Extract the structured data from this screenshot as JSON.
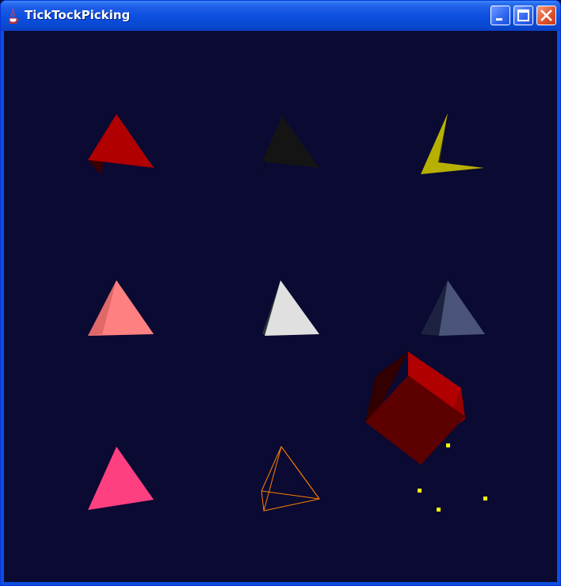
{
  "window": {
    "title": "TickTockPicking",
    "background_color": "#0a0a33",
    "icons": {
      "app": "java-coffee-cup-icon",
      "minimize": "minimize-icon",
      "maximize": "maximize-icon",
      "close": "close-icon"
    }
  },
  "scene": {
    "tetrahedra": [
      {
        "name": "red",
        "front_color": "#b00000",
        "shadow_color": "#3a0000"
      },
      {
        "name": "black",
        "front_color": "#141414",
        "shadow_color": "#050505"
      },
      {
        "name": "yellow",
        "front_color": "#b8b000",
        "shadow_color": "#36360a"
      },
      {
        "name": "salmon",
        "front_color": "#ff8080",
        "shadow_color": "#e06060"
      },
      {
        "name": "white",
        "front_color": "#e0e0e0",
        "shadow_color": "#303838"
      },
      {
        "name": "slate",
        "front_color": "#4a5478",
        "shadow_color": "#1c2240"
      },
      {
        "name": "pink",
        "front_color": "#ff4080",
        "shadow_color": "#d83070"
      },
      {
        "name": "orange-wireframe",
        "front_color": "#ff8000",
        "wireframe": true
      }
    ],
    "cube": {
      "front_color": "#5c0000",
      "top_color": "#b00000",
      "side_color": "#320000",
      "right_color": "#9a0000"
    },
    "points": {
      "color": "#ffff00",
      "count": 4
    }
  }
}
